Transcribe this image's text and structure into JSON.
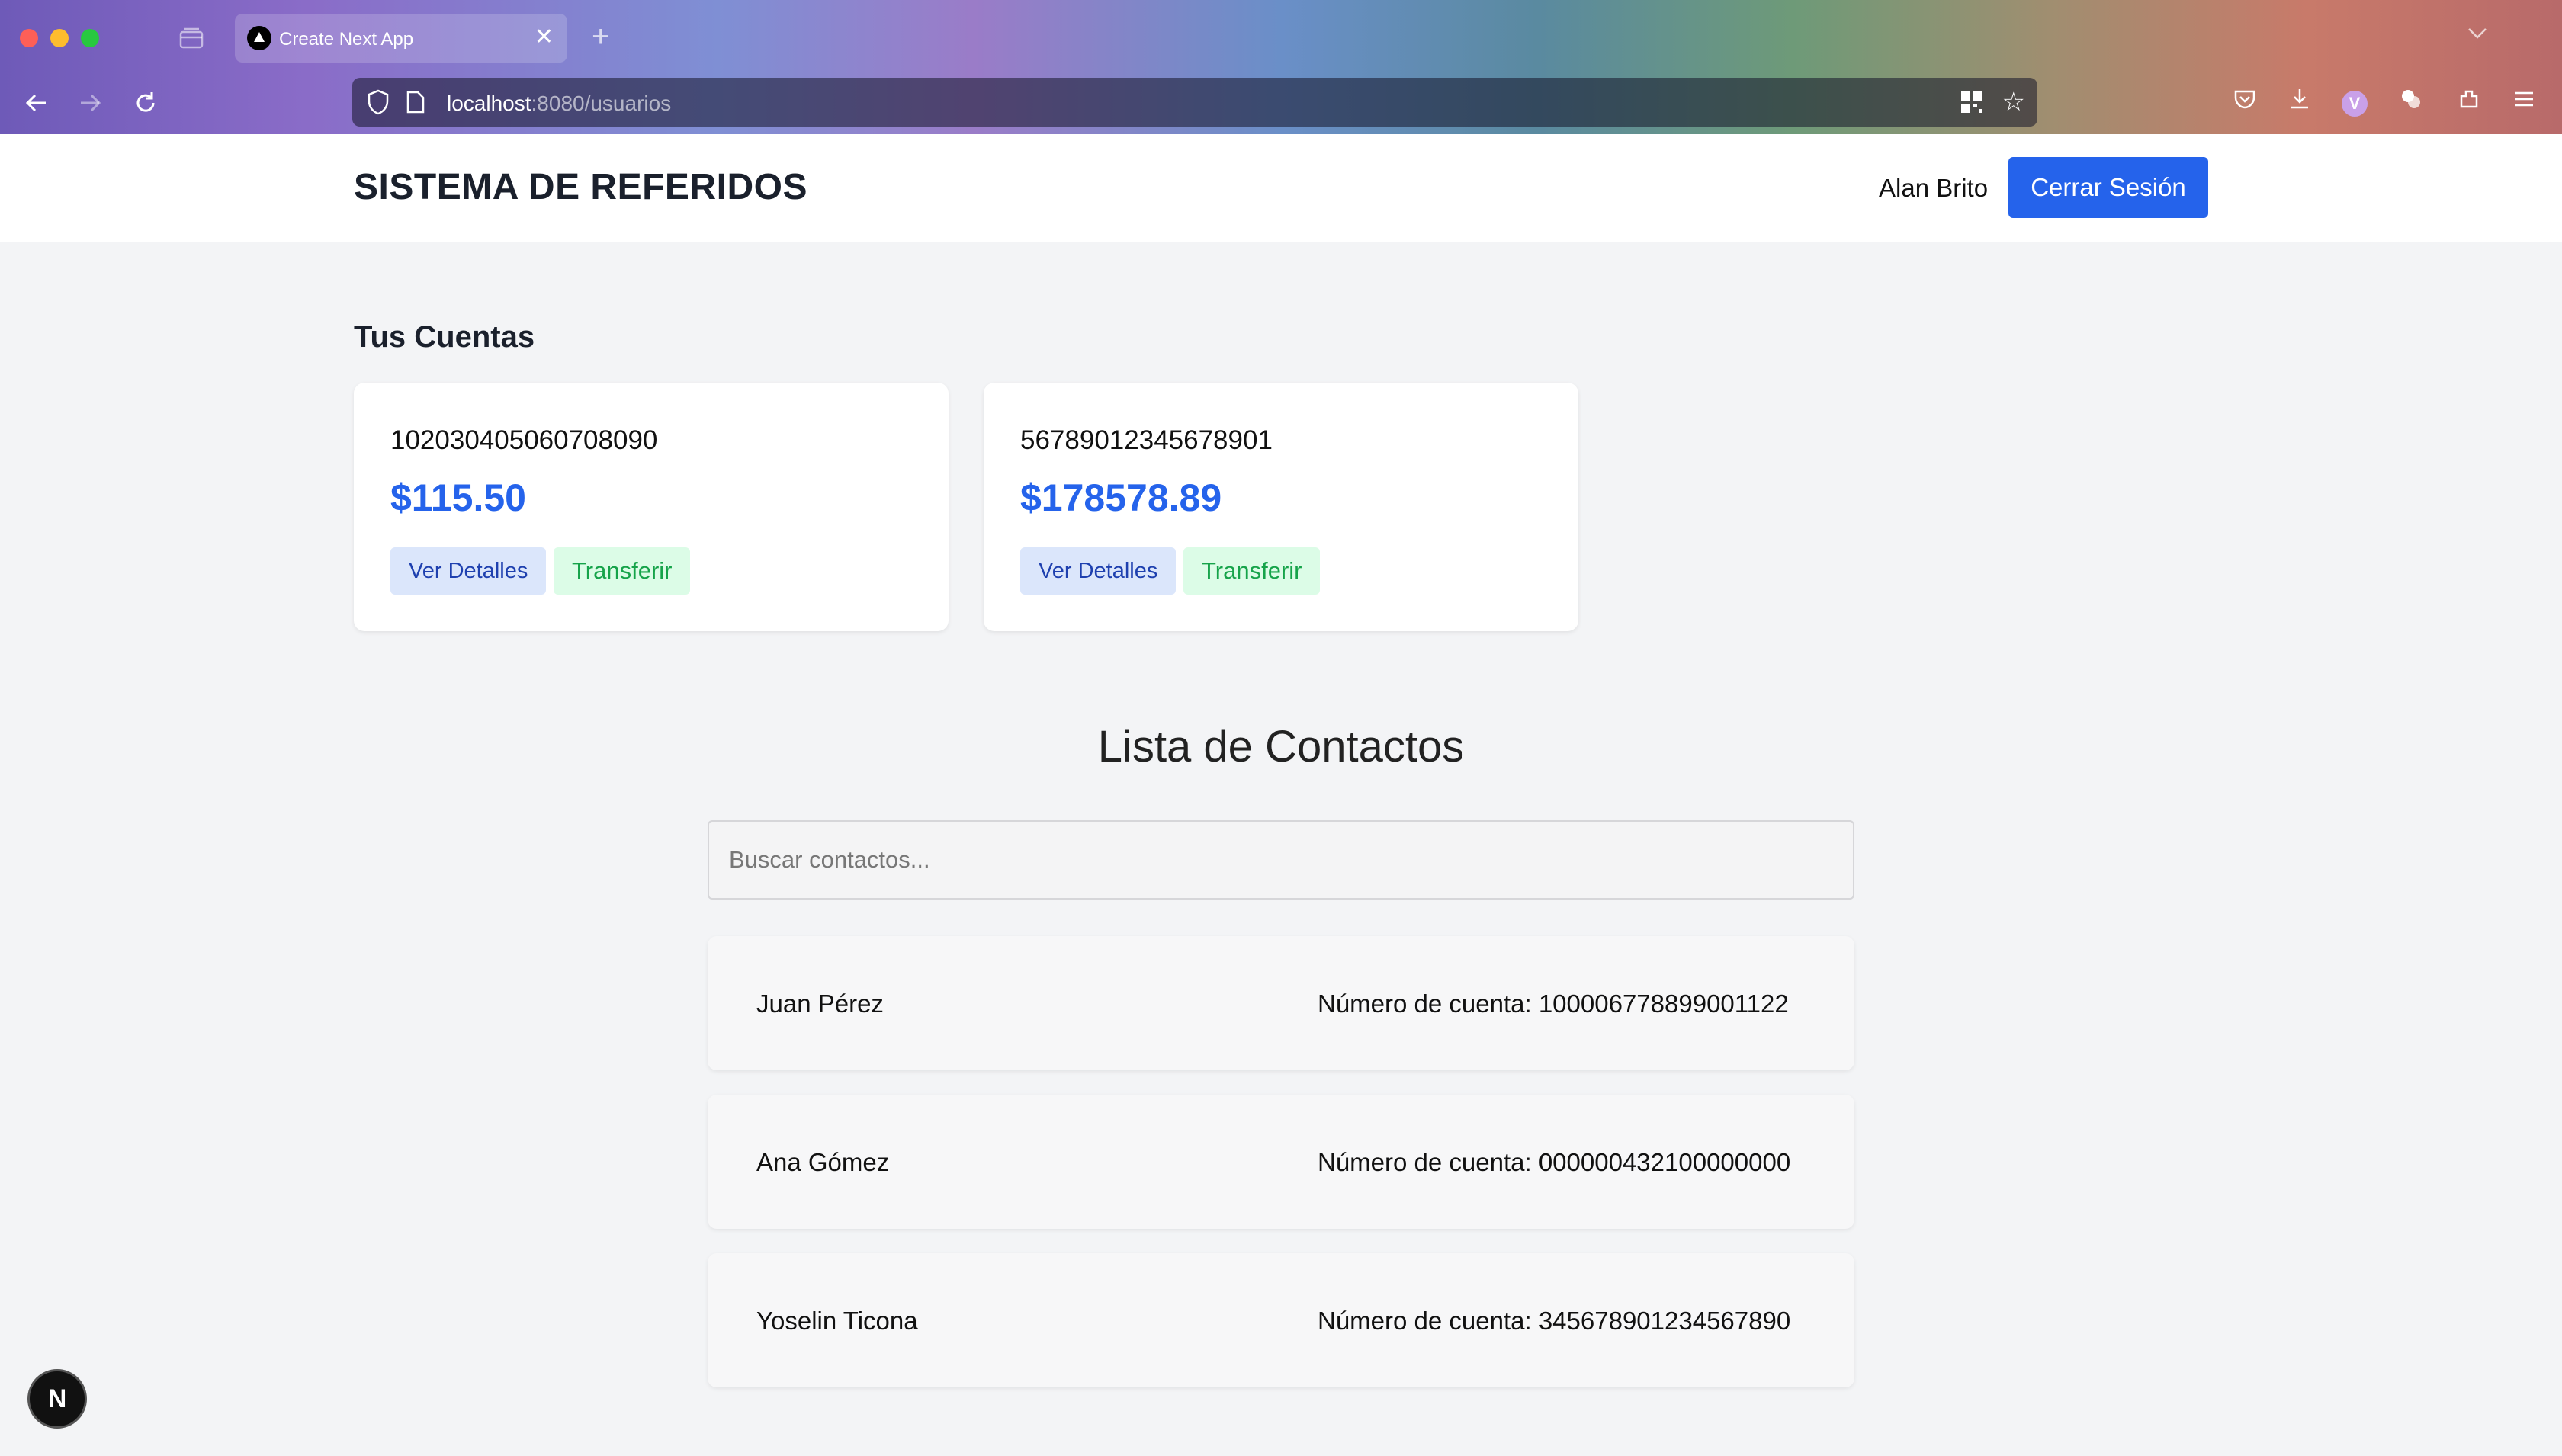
{
  "browser": {
    "tab_title": "Create Next App",
    "url_host": "localhost",
    "url_rest": ":8080/usuarios"
  },
  "header": {
    "brand": "SISTEMA DE REFERIDOS",
    "username": "Alan Brito",
    "logout_label": "Cerrar Sesión"
  },
  "accounts": {
    "title": "Tus Cuentas",
    "items": [
      {
        "number": "102030405060708090",
        "balance": "$115.50",
        "details_label": "Ver Detalles",
        "transfer_label": "Transferir"
      },
      {
        "number": "56789012345678901",
        "balance": "$178578.89",
        "details_label": "Ver Detalles",
        "transfer_label": "Transferir"
      }
    ]
  },
  "contacts": {
    "title": "Lista de Contactos",
    "search_placeholder": "Buscar contactos...",
    "items": [
      {
        "name": "Juan Pérez",
        "account": "Número de cuenta: 100006778899001122"
      },
      {
        "name": "Ana Gómez",
        "account": "Número de cuenta: 000000432100000000"
      },
      {
        "name": "Yoselin Ticona",
        "account": "Número de cuenta: 345678901234567890"
      }
    ]
  },
  "next_badge": "N",
  "colors": {
    "primary": "#2563eb",
    "transfer": "#16a34a",
    "page_bg": "#f3f4f6"
  }
}
